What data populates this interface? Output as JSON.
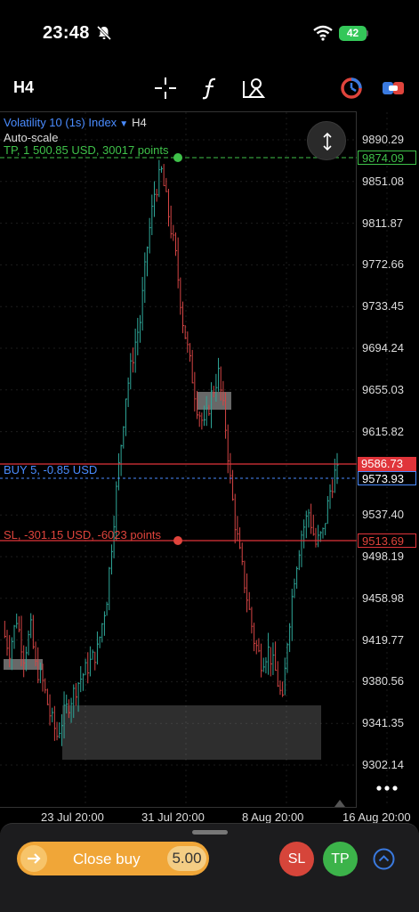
{
  "status_bar": {
    "time": "23:48",
    "battery": "42"
  },
  "toolbar": {
    "timeframe": "H4"
  },
  "chart": {
    "symbol": "Volatility 10 (1s) Index",
    "timeframe": "H4",
    "autoscale_label": "Auto-scale",
    "tp_label": "TP, 1 500.85 USD, 30017 points",
    "buy_label": "BUY 5, -0.85 USD",
    "sl_label": "SL, -301.15 USD, -6023 points",
    "tp_price": "9874.09",
    "buy_price": "9586.73",
    "bid_price": "9573.93",
    "sl_price": "9513.69",
    "price_ticks": [
      "9890.29",
      "9851.08",
      "9811.87",
      "9772.66",
      "9733.45",
      "9694.24",
      "9655.03",
      "9615.82",
      "9537.40",
      "9498.19",
      "9458.98",
      "9419.77",
      "9380.56",
      "9341.35",
      "9302.14"
    ],
    "date_ticks": [
      "23 Jul 20:00",
      "31 Jul 20:00",
      "8 Aug 20:00",
      "16 Aug 20:00"
    ],
    "colors": {
      "tp": "#3fc24a",
      "buy": "#e0343a",
      "bid": "#4a8cff",
      "sl": "#e0343a",
      "bull": "#2fa89a",
      "bear": "#d64545"
    }
  },
  "chart_data": {
    "type": "candlestick",
    "symbol": "Volatility 10 (1s) Index",
    "timeframe": "H4",
    "x_ticks": [
      "23 Jul 20:00",
      "31 Jul 20:00",
      "8 Aug 20:00",
      "16 Aug 20:00"
    ],
    "y_ticks": [
      9890.29,
      9851.08,
      9811.87,
      9772.66,
      9733.45,
      9694.24,
      9655.03,
      9615.82,
      9537.4,
      9498.19,
      9458.98,
      9419.77,
      9380.56,
      9341.35,
      9302.14
    ],
    "ylim": [
      9291,
      9905
    ],
    "levels": {
      "take_profit": 9874.09,
      "entry_buy": 9586.73,
      "current_bid": 9573.93,
      "stop_loss": 9513.69
    },
    "close_path": [
      [
        0,
        9430
      ],
      [
        3,
        9410
      ],
      [
        6,
        9440
      ],
      [
        9,
        9405
      ],
      [
        12,
        9430
      ],
      [
        14,
        9395
      ],
      [
        17,
        9380
      ],
      [
        20,
        9350
      ],
      [
        23,
        9330
      ],
      [
        26,
        9350
      ],
      [
        29,
        9365
      ],
      [
        32,
        9380
      ],
      [
        36,
        9395
      ],
      [
        40,
        9410
      ],
      [
        44,
        9460
      ],
      [
        48,
        9560
      ],
      [
        52,
        9650
      ],
      [
        56,
        9700
      ],
      [
        58,
        9720
      ],
      [
        61,
        9790
      ],
      [
        64,
        9840
      ],
      [
        67,
        9860
      ],
      [
        70,
        9820
      ],
      [
        73,
        9780
      ],
      [
        76,
        9720
      ],
      [
        79,
        9680
      ],
      [
        82,
        9640
      ],
      [
        85,
        9620
      ],
      [
        88,
        9650
      ],
      [
        91,
        9670
      ],
      [
        94,
        9620
      ],
      [
        96,
        9570
      ],
      [
        98,
        9530
      ],
      [
        100,
        9500
      ],
      [
        103,
        9460
      ],
      [
        106,
        9420
      ],
      [
        109,
        9400
      ],
      [
        112,
        9410
      ],
      [
        115,
        9390
      ],
      [
        118,
        9360
      ],
      [
        120,
        9420
      ],
      [
        123,
        9480
      ],
      [
        126,
        9520
      ],
      [
        129,
        9540
      ],
      [
        132,
        9510
      ],
      [
        135,
        9520
      ],
      [
        138,
        9560
      ],
      [
        140,
        9576
      ]
    ],
    "x_range": [
      0,
      142
    ]
  },
  "panel": {
    "close_label": "Close buy",
    "volume": "5.00",
    "sl_label": "SL",
    "tp_label": "TP"
  },
  "icons": [
    "bell-slash-icon",
    "wifi-icon",
    "crosshair-icon",
    "function-icon",
    "drawing-tools-icon",
    "indicator-icon",
    "trade-mode-icon",
    "vertical-scale-icon",
    "more-icon",
    "arrow-right-icon",
    "chevron-up-icon"
  ]
}
